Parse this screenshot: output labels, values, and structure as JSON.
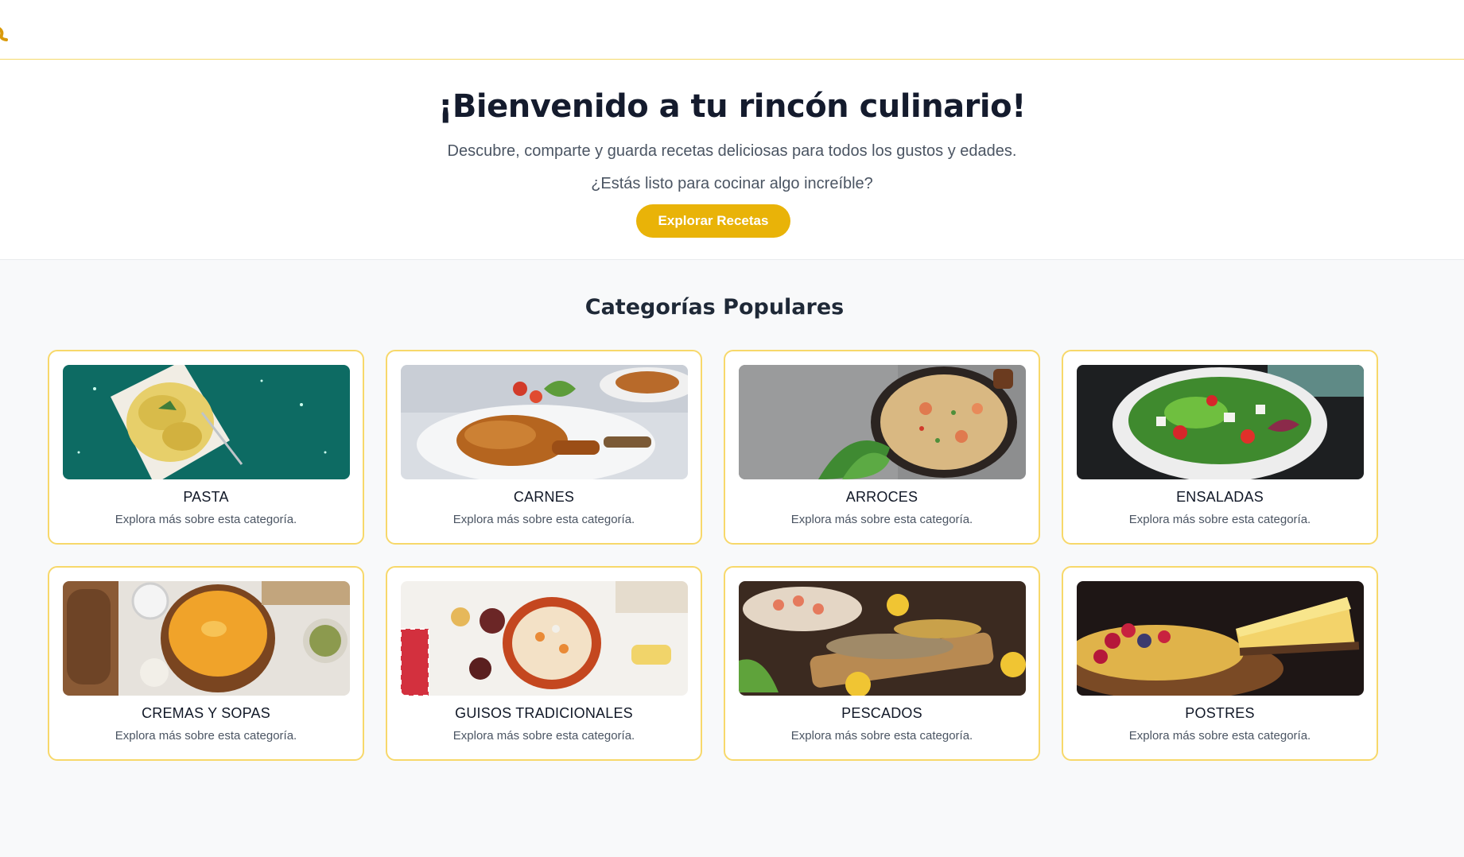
{
  "header": {
    "logo_icon": "chef-hat-icon",
    "accent_color": "#e9b308"
  },
  "hero": {
    "title": "¡Bienvenido a tu rincón culinario!",
    "subtitle": "Descubre, comparte y guarda recetas deliciosas para todos los gustos y edades.",
    "question": "¿Estás listo para cocinar algo increíble?",
    "cta_label": "Explorar Recetas"
  },
  "categories": {
    "title": "Categorías Populares",
    "items": [
      {
        "name": "PASTA",
        "description": "Explora más sobre esta categoría."
      },
      {
        "name": "CARNES",
        "description": "Explora más sobre esta categoría."
      },
      {
        "name": "ARROCES",
        "description": "Explora más sobre esta categoría."
      },
      {
        "name": "ENSALADAS",
        "description": "Explora más sobre esta categoría."
      },
      {
        "name": "CREMAS Y SOPAS",
        "description": "Explora más sobre esta categoría."
      },
      {
        "name": "GUISOS TRADICIONALES",
        "description": "Explora más sobre esta categoría."
      },
      {
        "name": "PESCADOS",
        "description": "Explora más sobre esta categoría."
      },
      {
        "name": "POSTRES",
        "description": "Explora más sobre esta categoría."
      }
    ]
  }
}
